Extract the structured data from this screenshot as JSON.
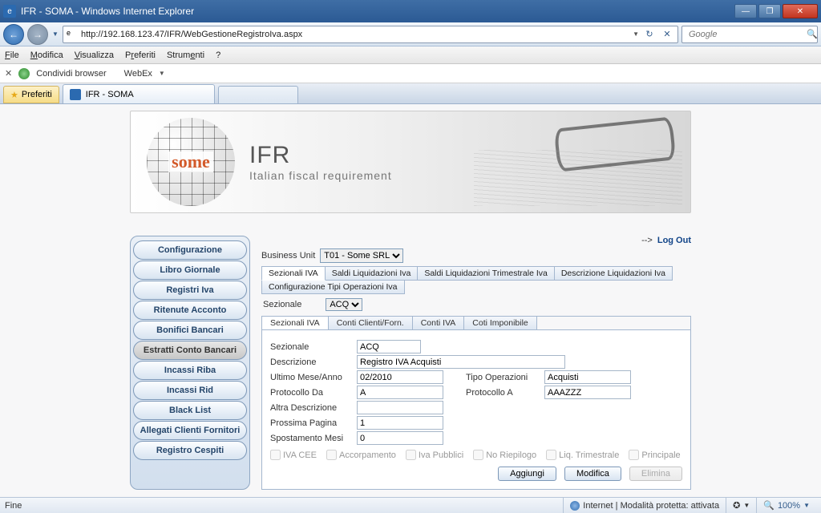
{
  "window": {
    "title": "IFR - SOMA - Windows Internet Explorer"
  },
  "nav": {
    "url": "http://192.168.123.47/IFR/WebGestioneRegistroIva.aspx",
    "search_placeholder": "Google"
  },
  "menus": {
    "file": "File",
    "modifica": "Modifica",
    "visualizza": "Visualizza",
    "preferiti": "Preferiti",
    "strumenti": "Strumenti",
    "help": "?"
  },
  "sharebar": {
    "label": "Condividi browser",
    "app": "WebEx"
  },
  "tabs": {
    "fav": "Preferiti",
    "page": "IFR - SOMA"
  },
  "banner": {
    "brand": "some",
    "title": "IFR",
    "subtitle": "Italian fiscal requirement"
  },
  "logout": {
    "arrow": "-->",
    "label": "Log Out"
  },
  "bu": {
    "label": "Business Unit",
    "value": "T01 - Some SRL"
  },
  "maintabs": {
    "t1": "Sezionali IVA",
    "t2": "Saldi Liquidazioni Iva",
    "t3": "Saldi Liquidazioni Trimestrale Iva",
    "t4": "Descrizione Liquidazioni Iva",
    "t5": "Configurazione Tipi Operazioni Iva"
  },
  "sezionale": {
    "label": "Sezionale",
    "value": "ACQ"
  },
  "subtabs": {
    "s1": "Sezionali IVA",
    "s2": "Conti Clienti/Forn.",
    "s3": "Conti IVA",
    "s4": "Coti Imponibile"
  },
  "sidebar": {
    "b1": "Configurazione",
    "b2": "Libro Giornale",
    "b3": "Registri Iva",
    "b4": "Ritenute Acconto",
    "b5": "Bonifici Bancari",
    "b6": "Estratti Conto Bancari",
    "b7": "Incassi Riba",
    "b8": "Incassi Rid",
    "b9": "Black List",
    "b10": "Allegati Clienti Fornitori",
    "b11": "Registro Cespiti"
  },
  "form": {
    "f_sezionale_l": "Sezionale",
    "f_sezionale_v": "ACQ",
    "f_descr_l": "Descrizione",
    "f_descr_v": "Registro IVA Acquisti",
    "f_um_l": "Ultimo Mese/Anno",
    "f_um_v": "02/2010",
    "f_tipo_l": "Tipo Operazioni",
    "f_tipo_v": "Acquisti",
    "f_pda_l": "Protocollo Da",
    "f_pda_v": "A",
    "f_pa_l": "Protocollo A",
    "f_pa_v": "AAAZZZ",
    "f_altra_l": "Altra Descrizione",
    "f_altra_v": "",
    "f_pp_l": "Prossima Pagina",
    "f_pp_v": "1",
    "f_sm_l": "Spostamento Mesi",
    "f_sm_v": "0"
  },
  "checks": {
    "c1": "IVA CEE",
    "c2": "Accorpamento",
    "c3": "Iva Pubblici",
    "c4": "No Riepilogo",
    "c5": "Liq. Trimestrale",
    "c6": "Principale"
  },
  "actions": {
    "add": "Aggiungi",
    "mod": "Modifica",
    "del": "Elimina"
  },
  "status": {
    "left": "Fine",
    "zone": "Internet | Modalità protetta: attivata",
    "zoom": "100%"
  }
}
